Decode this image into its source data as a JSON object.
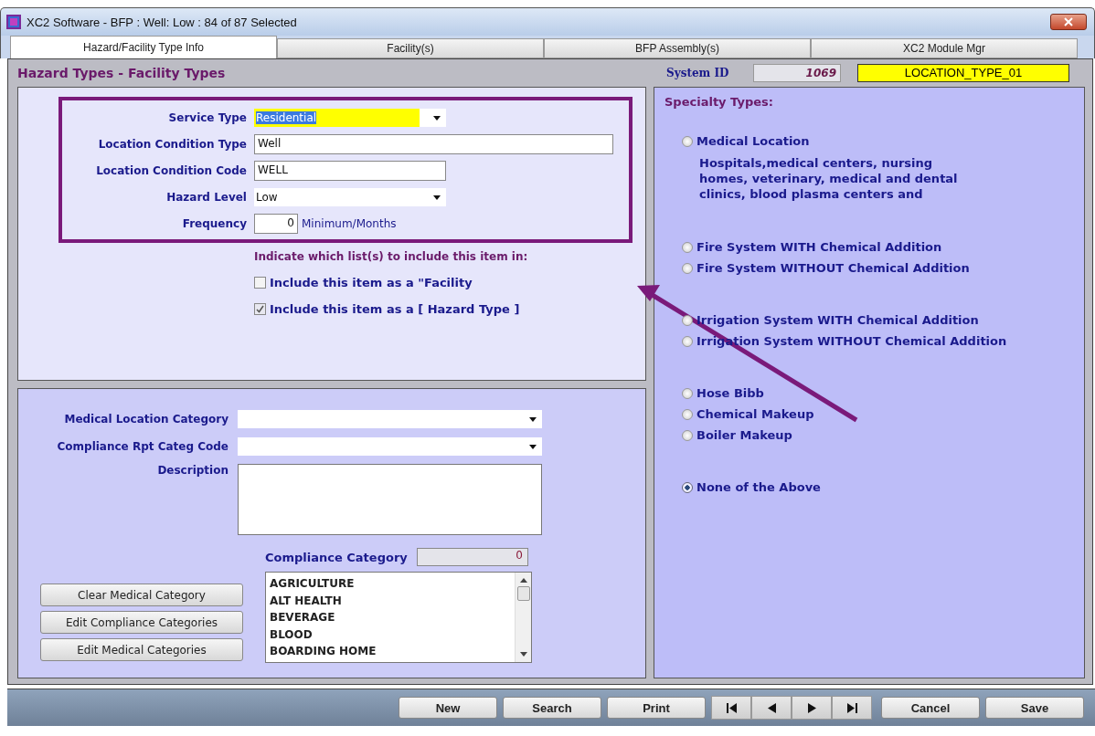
{
  "window": {
    "title": "XC2 Software - BFP : Well: Low : 84 of 87 Selected"
  },
  "tabs": [
    {
      "label": "Hazard/Facility Type Info",
      "selected": true
    },
    {
      "label": "Facility(s)",
      "selected": false
    },
    {
      "label": "BFP Assembly(s)",
      "selected": false
    },
    {
      "label": "XC2 Module Mgr",
      "selected": false
    }
  ],
  "header": {
    "title": "Hazard Types - Facility Types",
    "system_id_label": "System ID",
    "system_id": "1069",
    "code": "LOCATION_TYPE_01"
  },
  "main_fields": [
    {
      "label": "Service Type",
      "kind": "select",
      "value": "Residential",
      "focused": true
    },
    {
      "label": "Location Condition Type",
      "kind": "text",
      "value": "Well",
      "focused": false
    },
    {
      "label": "Location Condition Code",
      "kind": "text",
      "value": "WELL",
      "focused": false
    },
    {
      "label": "Hazard Level",
      "kind": "select",
      "value": "Low",
      "focused": false
    },
    {
      "label": "Frequency",
      "kind": "number",
      "value": "0",
      "unit": "Minimum/Months",
      "focused": false
    }
  ],
  "include": {
    "prompt": "Indicate which list(s) to include this item in:",
    "options": [
      {
        "label": "Include this item as a \"Facility",
        "checked": false
      },
      {
        "label": "Include this item as a [ Hazard Type ]",
        "checked": true
      }
    ]
  },
  "category_fields": [
    {
      "label": "Medical Location Category",
      "kind": "select"
    },
    {
      "label": "Compliance Rpt Categ Code",
      "kind": "select"
    },
    {
      "label": "Description",
      "kind": "textarea"
    }
  ],
  "compliance": {
    "label": "Compliance Category",
    "count": "0",
    "items": [
      "AGRICULTURE",
      "ALT HEALTH",
      "BEVERAGE",
      "BLOOD",
      "BOARDING HOME"
    ]
  },
  "side_buttons": [
    "Clear Medical Category",
    "Edit Compliance Categories",
    "Edit Medical Categories"
  ],
  "specialty_types": {
    "title": "Specialty Types:",
    "groups": [
      [
        {
          "label": "Medical Location",
          "selected": false,
          "description": "Hospitals,medical centers, nursing homes, veterinary, medical and dental clinics, blood plasma centers and"
        }
      ],
      [
        {
          "label": "Fire System WITH Chemical Addition",
          "selected": false
        },
        {
          "label": "Fire System WITHOUT Chemical Addition",
          "selected": false
        }
      ],
      [
        {
          "label": "Irrigation System WITH Chemical Addition",
          "selected": false
        },
        {
          "label": "Irrigation System WITHOUT Chemical Addition",
          "selected": false
        }
      ],
      [
        {
          "label": "Hose Bibb",
          "selected": false
        },
        {
          "label": "Chemical Makeup",
          "selected": false
        },
        {
          "label": "Boiler Makeup",
          "selected": false
        }
      ],
      [
        {
          "label": "None of the Above",
          "selected": true
        }
      ]
    ]
  },
  "toolbar": [
    {
      "kind": "text",
      "label": "New"
    },
    {
      "kind": "text",
      "label": "Search"
    },
    {
      "kind": "text",
      "label": "Print"
    },
    {
      "kind": "first"
    },
    {
      "kind": "prev"
    },
    {
      "kind": "next"
    },
    {
      "kind": "last"
    },
    {
      "kind": "text",
      "label": "Cancel"
    },
    {
      "kind": "text",
      "label": "Save"
    }
  ]
}
